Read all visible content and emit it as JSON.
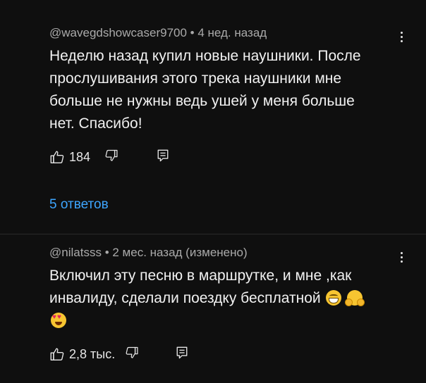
{
  "comments": [
    {
      "author": "@wavegdshowcaser9700",
      "separator": "•",
      "time": "4 нед. назад",
      "text_lines": [
        "Неделю назад купил новые наушники. После",
        "прослушивания этого трека наушники мне",
        "больше не нужны ведь ушей у меня больше",
        "нет. Спасибо!"
      ],
      "likes": "184",
      "replies_label": "5 ответов"
    },
    {
      "author": "@nilatsss",
      "separator": "•",
      "time": "2 мес. назад (изменено)",
      "text_lines": [
        "Включил эту песню в маршрутке, и мне ,как",
        "инвалиду, сделали поездку бесплатной"
      ],
      "emojis": [
        "grinning-face-emoji",
        "hugging-face-emoji",
        "heart-eyes-emoji"
      ],
      "likes": "2,8 тыс."
    }
  ],
  "colors": {
    "background": "#0f0f0f",
    "text": "#f1f1f1",
    "meta": "#aaaaaa",
    "link": "#3ea6ff"
  }
}
